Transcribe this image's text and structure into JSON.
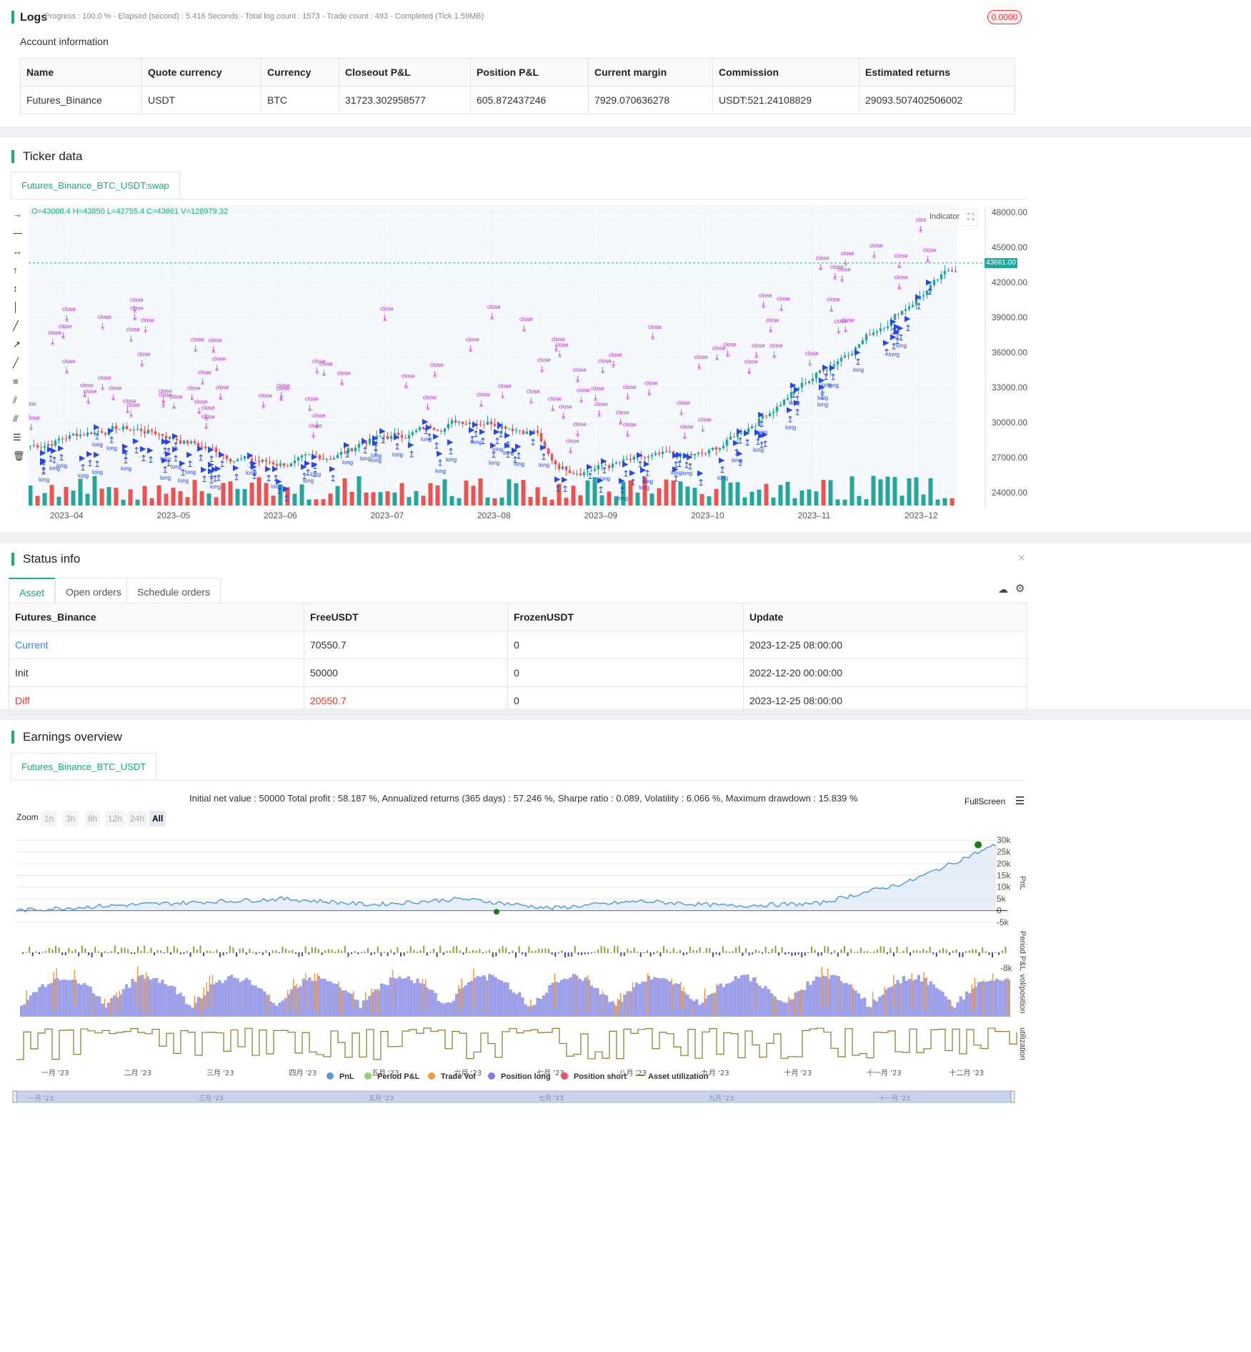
{
  "logs": {
    "title": "Logs",
    "progress_line": "Progress : 100.0 % - Elapsed (second) : 5.416  Seconds - Total log count : 1573 - Trade count : 493 - Completed (Tick 1.59MB)",
    "badge": "0.0000"
  },
  "account": {
    "title": "Account information",
    "headers": [
      "Name",
      "Quote currency",
      "Currency",
      "Closeout P&L",
      "Position P&L",
      "Current margin",
      "Commission",
      "Estimated returns"
    ],
    "row": [
      "Futures_Binance",
      "USDT",
      "BTC",
      "31723.302958577",
      "605.872437246",
      "7929.070636278",
      "USDT:521.24108829",
      "29093.507402506002"
    ]
  },
  "ticker": {
    "title": "Ticker data",
    "tab": "Futures_Binance_BTC_USDT:swap",
    "ohlc": "O=43008.4 H=43850 L=42755.4 C=43661 V=128979.32",
    "indicator_btn": "Indicator",
    "current_price": "43661.00",
    "y_ticks": [
      "48000.00",
      "45000.00",
      "42000.00",
      "39000.00",
      "36000.00",
      "33000.00",
      "30000.00",
      "27000.00",
      "24000.00"
    ],
    "x_ticks": [
      "2023–04",
      "2023–05",
      "2023–06",
      "2023–07",
      "2023–08",
      "2023–09",
      "2023–10",
      "2023–11",
      "2023–12"
    ],
    "marker_close": "close",
    "marker_long": "long"
  },
  "status": {
    "title": "Status info",
    "tabs": [
      "Asset",
      "Open orders",
      "Schedule orders"
    ],
    "headers": [
      "Futures_Binance",
      "FreeUSDT",
      "FrozenUSDT",
      "Update"
    ],
    "rows": [
      [
        "Current",
        "70550.7",
        "0",
        "2023-12-25 08:00:00"
      ],
      [
        "Init",
        "50000",
        "0",
        "2022-12-20 00:00:00"
      ],
      [
        "Diff",
        "20550.7",
        "0",
        "2023-12-25 08:00:00"
      ]
    ]
  },
  "earnings": {
    "title": "Earnings overview",
    "tab": "Futures_Binance_BTC_USDT",
    "summary": "Initial net value : 50000 Total profit : 58.187 %, Annualized returns (365 days) : 57.246 %, Sharpe ratio : 0.089, Volatility : 6.066 %, Maximum drawdown : 15.839 %",
    "fullscreen": "FullScreen",
    "zoom_label": "Zoom",
    "zoom_options": [
      "1h",
      "3h",
      "8h",
      "12h",
      "24h",
      "All"
    ],
    "pnl_ticks": [
      "30k",
      "25k",
      "20k",
      "15k",
      "10k",
      "5k",
      "0",
      "-5k"
    ],
    "period_tick": "-8k",
    "axis_titles": [
      "PnL",
      "Period P&L",
      "vol/position",
      "utilization"
    ],
    "months": [
      "一月 '23",
      "二月 '23",
      "三月 '23",
      "四月 '23",
      "五月 '23",
      "六月 '23",
      "七月 '23",
      "八月 '23",
      "九月 '23",
      "十月 '23",
      "十一月 '23",
      "十二月 '23"
    ],
    "nav_months": [
      "一月 '23",
      "三月 '23",
      "五月 '23",
      "七月 '23",
      "九月 '23",
      "十一月 '23"
    ],
    "legend": [
      "PnL",
      "Period P&L",
      "Trade Vol",
      "Position long",
      "Position short",
      "Asset utilization"
    ]
  },
  "colors": {
    "accent": "#1aad73",
    "up": "#26a69a",
    "down": "#ef5350",
    "marker_close": "#c026d3",
    "marker_long": "#2947e6",
    "pnl": "#5b9bd5"
  },
  "chart_data": [
    {
      "type": "candlestick",
      "title": "",
      "x_range": [
        "2023-03",
        "2023-12"
      ],
      "ylim": [
        24000,
        48000
      ],
      "last": {
        "open": 43008.4,
        "high": 43850,
        "low": 42755.4,
        "close": 43661,
        "volume": 128979.32
      },
      "grid": true
    },
    {
      "type": "line",
      "name": "PnL",
      "x": [
        "2023-01",
        "2023-02",
        "2023-03",
        "2023-04",
        "2023-05",
        "2023-06",
        "2023-07",
        "2023-08",
        "2023-09",
        "2023-10",
        "2023-11",
        "2023-12"
      ],
      "values": [
        0,
        2000,
        3500,
        5000,
        2500,
        5000,
        1000,
        4000,
        2000,
        3000,
        12000,
        28000
      ],
      "ylim": [
        -5000,
        30000
      ]
    }
  ]
}
